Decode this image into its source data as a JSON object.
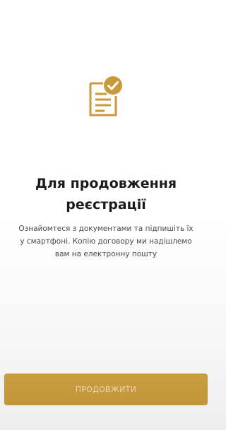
{
  "screen": {
    "icon": "document-check-icon",
    "title": "Для продовження реєстрації",
    "description": "Ознайомтеся з документами та підпишіть їх у смартфоні. Копію договору ми надішлемо вам на електронну пошту",
    "continue_label": "ПРОДОВЖИТИ"
  },
  "colors": {
    "accent": "#c89a3c",
    "button_text": "#e9d6ae",
    "title_text": "#1b1b1b",
    "body_text": "#4a4a4a"
  }
}
